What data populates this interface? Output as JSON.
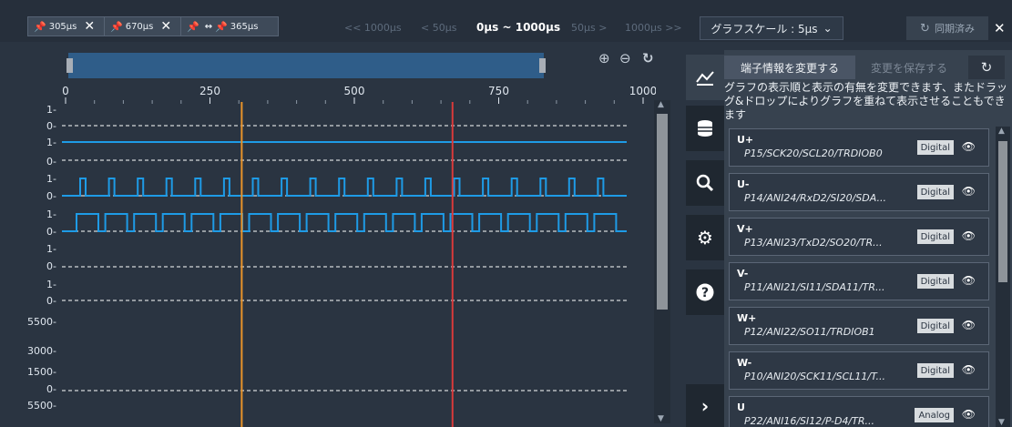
{
  "markers": {
    "m1": "305μs",
    "m2": "670μs",
    "diff": "365μs",
    "close": "✕",
    "link": "↔"
  },
  "range_nav": {
    "back_1000": "<< 1000μs",
    "back_50": "< 50μs",
    "range": "0μs ~ 1000μs",
    "fwd_50": "50μs >",
    "fwd_1000": "1000μs >>"
  },
  "scale": {
    "label": "グラフスケール : 5μs",
    "chevron": "⌄"
  },
  "sync": {
    "label": "同期済み"
  },
  "close_top": "✕",
  "zoom": {
    "in": "⊕",
    "out": "⊖",
    "reset": "↻"
  },
  "x_axis": {
    "ticks": [
      "0",
      "250",
      "500",
      "750",
      "1000"
    ],
    "min": 0,
    "max": 1000
  },
  "y_labels": [
    "1",
    "0",
    "1",
    "0",
    "1",
    "0",
    "1",
    "0",
    "1",
    "0",
    "1",
    "0",
    "5500",
    "3000",
    "1500",
    "0",
    "5500"
  ],
  "cursors": {
    "orange_us": 305,
    "red_us": 670,
    "orange_color": "#e8932a",
    "red_color": "#d93a3a"
  },
  "signals": {
    "u_plus": "flat-high",
    "u_minus": "flat-low",
    "v_plus_pulses": 19,
    "v_minus_pulses": 19
  },
  "tabs": [
    "chart-icon",
    "database-icon",
    "search-icon",
    "gear-icon",
    "help-icon",
    "expand-icon"
  ],
  "panel": {
    "change_btn": "端子情報を変更する",
    "save_btn": "変更を保存する",
    "reset_icon": "↻",
    "help": "グラフの表示順と表示の有無を変更できます、またドラッグ&ドロップによりグラフを重ねて表示させることもできます",
    "channels": [
      {
        "name": "U+",
        "pins": "P15/SCK20/SCL20/TRDIOB0",
        "type": "Digital"
      },
      {
        "name": "U-",
        "pins": "P14/ANI24/RxD2/SI20/SDA...",
        "type": "Digital"
      },
      {
        "name": "V+",
        "pins": "P13/ANI23/TxD2/SO20/TR...",
        "type": "Digital"
      },
      {
        "name": "V-",
        "pins": "P11/ANI21/SI11/SDA11/TR...",
        "type": "Digital"
      },
      {
        "name": "W+",
        "pins": "P12/ANI22/SO11/TRDIOB1",
        "type": "Digital"
      },
      {
        "name": "W-",
        "pins": "P10/ANI20/SCK11/SCL11/T...",
        "type": "Digital"
      },
      {
        "name": "U",
        "pins": "P22/ANI16/SI12/P-D4/TR...",
        "type": "Analog"
      }
    ]
  }
}
